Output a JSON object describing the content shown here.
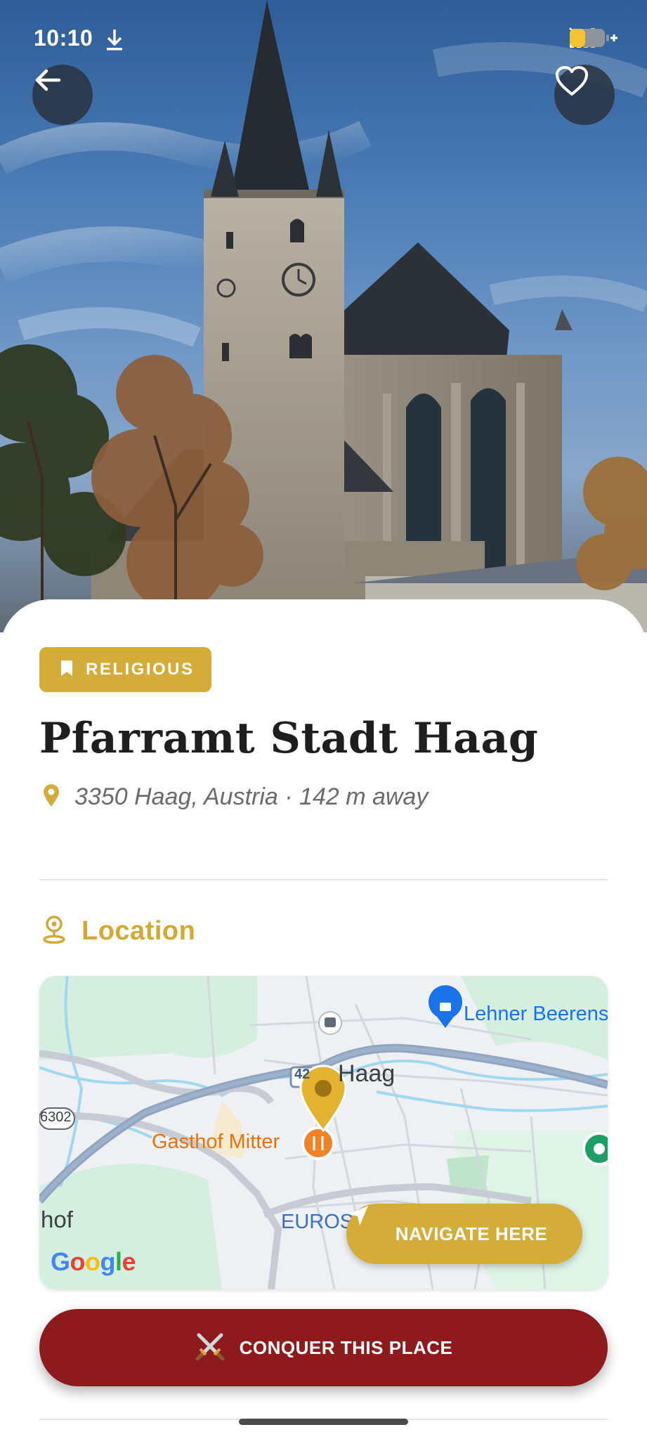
{
  "status_bar": {
    "time": "10:10",
    "icons": [
      "download-icon",
      "mute-icon",
      "signal-icon",
      "wifi-icon",
      "battery-charging-icon"
    ]
  },
  "header": {
    "back_icon": "arrow-left-icon",
    "favorite_icon": "heart-outline-icon"
  },
  "place": {
    "category": "RELIGIOUS",
    "category_icon": "bookmark-icon",
    "name": "Pfarramt Stadt Haag",
    "address": "3350 Haag, Austria · 142 m away",
    "address_icon": "map-pin-icon"
  },
  "location_section": {
    "title": "Location",
    "icon": "location-person-icon"
  },
  "map": {
    "labels": {
      "poi_top_right": "Lehner Beerens",
      "road_sign_42": "42",
      "town": "Haag",
      "road_sign_6302": "6302",
      "restaurant": "Gasthof Mitter",
      "place_left": "hof",
      "place_bottom": "EUROS"
    },
    "attribution": "Google",
    "navigate_label": "NAVIGATE HERE",
    "navigate_icon": "navigation-arrow-icon"
  },
  "actions": {
    "conquer_label": "CONQUER THIS PLACE",
    "conquer_icon": "crossed-swords-icon"
  },
  "colors": {
    "accent_gold": "#d4ac3a",
    "conquer_red": "#8d1b1d",
    "title_text": "#1e1e1e",
    "muted_text": "#6a6a6a"
  }
}
